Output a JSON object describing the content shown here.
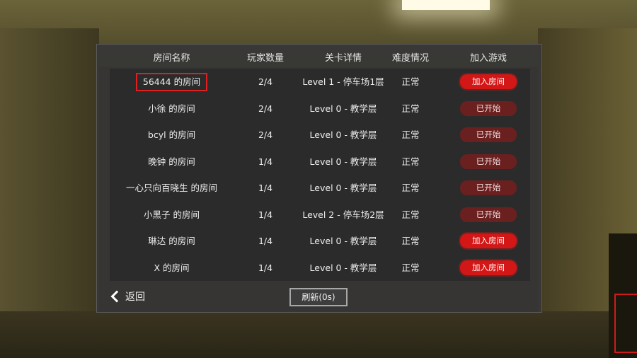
{
  "header": {
    "room_name": "房间名称",
    "players": "玩家数量",
    "level_detail": "关卡详情",
    "difficulty": "难度情况",
    "join_game": "加入游戏"
  },
  "rooms": [
    {
      "name": "56444 的房间",
      "players": "2/4",
      "level": "Level 1 - 停车场1层",
      "difficulty": "正常",
      "action": "加入房间",
      "state": "join",
      "highlighted": true
    },
    {
      "name": "小徐 的房间",
      "players": "2/4",
      "level": "Level 0 - 教学层",
      "difficulty": "正常",
      "action": "已开始",
      "state": "started"
    },
    {
      "name": "bcyl 的房间",
      "players": "2/4",
      "level": "Level 0 - 教学层",
      "difficulty": "正常",
      "action": "已开始",
      "state": "started"
    },
    {
      "name": "晚钟 的房间",
      "players": "1/4",
      "level": "Level 0 - 教学层",
      "difficulty": "正常",
      "action": "已开始",
      "state": "started"
    },
    {
      "name": "一心只向百晓生 的房间",
      "players": "1/4",
      "level": "Level 0 - 教学层",
      "difficulty": "正常",
      "action": "已开始",
      "state": "started"
    },
    {
      "name": "小黑子 的房间",
      "players": "1/4",
      "level": "Level 2 - 停车场2层",
      "difficulty": "正常",
      "action": "已开始",
      "state": "started"
    },
    {
      "name": "琳达 的房间",
      "players": "1/4",
      "level": "Level 0 - 教学层",
      "difficulty": "正常",
      "action": "加入房间",
      "state": "join"
    },
    {
      "name": "X 的房间",
      "players": "1/4",
      "level": "Level 0 - 教学层",
      "difficulty": "正常",
      "action": "加入房间",
      "state": "join"
    }
  ],
  "footer": {
    "back_label": "返回",
    "back_icon": "chevron-left-icon",
    "refresh_label": "刷新(0s)"
  },
  "colors": {
    "join_button": "#d31616",
    "started_button": "#6b2020",
    "highlight_border": "#e02020"
  }
}
